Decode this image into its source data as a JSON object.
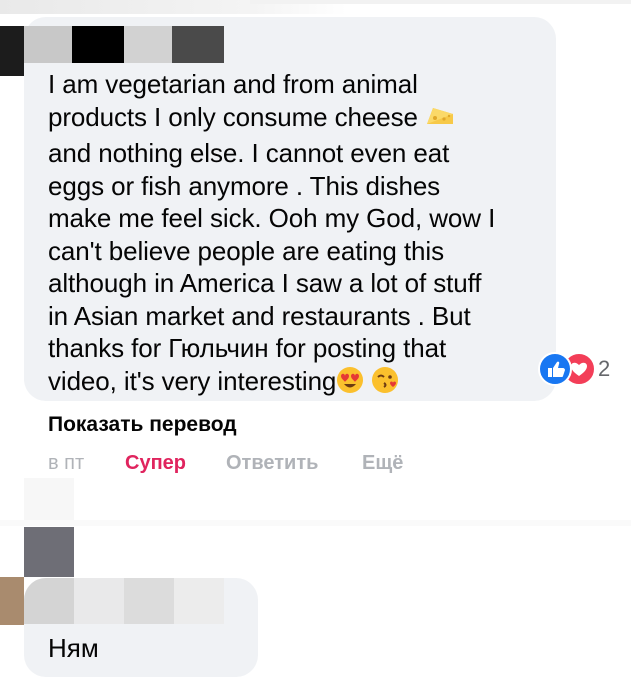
{
  "comment1": {
    "text_lines": [
      "I am vegetarian and from animal",
      "products I only consume cheese",
      "and nothing else. I cannot even eat",
      "eggs or fish anymore . This dishes",
      "make me feel sick. Ooh my God, wow I",
      "can't believe people are eating this",
      "although in America I saw a lot of stuff",
      "in Asian market and restaurants . But",
      "thanks for Гюльчин for posting that",
      "video, it's very interesting"
    ],
    "inline_emoji": [
      "cheese-emoji",
      "heart-eyes-emoji",
      "kissing-heart-emoji"
    ],
    "reactions": {
      "icons": [
        "like-icon",
        "love-icon"
      ],
      "count": "2"
    },
    "show_translation": "Показать перевод",
    "actions": {
      "time": "в пт",
      "react": "Супер",
      "reply": "Ответить",
      "more": "Ещё"
    }
  },
  "comment2": {
    "text": "Ням"
  },
  "colors": {
    "bubble": "#f0f2f5",
    "text": "#050505",
    "muted": "#b0b3b8",
    "react_super": "#e0245e",
    "like_blue": "#1877f2",
    "love_red": "#f33e58",
    "count_gray": "#65676b"
  }
}
